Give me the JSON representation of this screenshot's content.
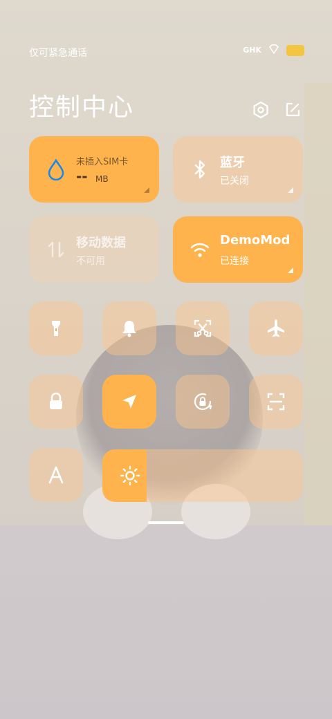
{
  "status_bar": {
    "carrier": "仅可紧急通话",
    "icons": [
      "hd-icon",
      "diamond-icon",
      "battery-icon"
    ],
    "hd_text": "GHK"
  },
  "header": {
    "title": "控制中心",
    "settings_icon": "settings-hexagon-icon",
    "edit_icon": "edit-icon"
  },
  "tiles": {
    "data_usage": {
      "line1": "未插入SIM卡",
      "value": "--",
      "unit": "MB",
      "state": "on"
    },
    "bluetooth": {
      "name": "蓝牙",
      "status": "已关闭",
      "state": "off"
    },
    "mobile_data": {
      "name": "移动数据",
      "status": "不可用",
      "state": "disabled"
    },
    "wifi": {
      "name": "DemoMod",
      "status": "已连接",
      "state": "on"
    }
  },
  "toggles": [
    {
      "id": "flashlight",
      "icon": "flashlight-icon",
      "state": "off"
    },
    {
      "id": "ring",
      "icon": "bell-icon",
      "state": "off"
    },
    {
      "id": "screenshot",
      "icon": "screenshot-scissors-icon",
      "state": "off"
    },
    {
      "id": "airplane",
      "icon": "airplane-icon",
      "state": "off"
    },
    {
      "id": "lock",
      "icon": "lock-icon",
      "state": "off"
    },
    {
      "id": "location",
      "icon": "location-arrow-icon",
      "state": "on"
    },
    {
      "id": "rotation_lock",
      "icon": "rotation-lock-icon",
      "state": "off"
    },
    {
      "id": "scanner",
      "icon": "scan-icon",
      "state": "off"
    },
    {
      "id": "auto_font",
      "icon": "font-a-icon",
      "state": "off"
    }
  ],
  "brightness": {
    "icon": "sun-icon",
    "level": 0.22
  },
  "colors": {
    "accent": "#ffb34c",
    "tile_off": "rgba(255,198,140,.45)",
    "text": "#ffffff"
  }
}
